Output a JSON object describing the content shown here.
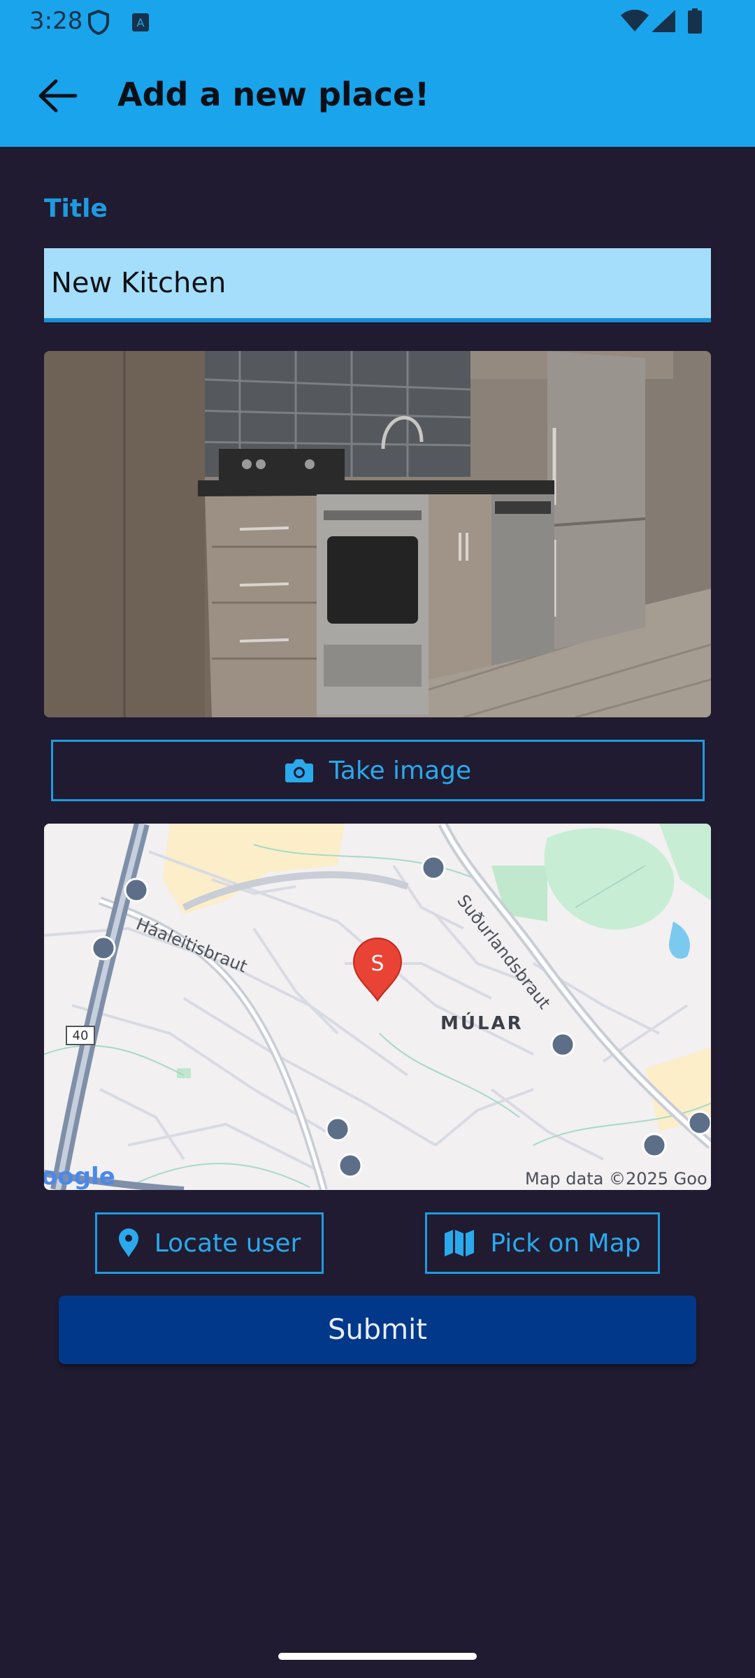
{
  "status_bar": {
    "time": "3:28",
    "icons": [
      "shield-icon",
      "keyboard-a-icon",
      "wifi-icon",
      "signal-icon",
      "battery-icon"
    ]
  },
  "app_bar": {
    "title": "Add a new place!",
    "back_icon": "arrow-left-icon"
  },
  "form": {
    "title_label": "Title",
    "title_value": "New Kitchen",
    "take_image_label": "Take image",
    "locate_user_label": "Locate user",
    "pick_on_map_label": "Pick on Map",
    "submit_label": "Submit"
  },
  "map": {
    "marker_label": "S",
    "street_1": "Háaleitisbraut",
    "street_2": "Suðurlandsbraut",
    "district": "MÚLAR",
    "road_number": "40",
    "logo_text": "oogle",
    "attribution": "Map data ©2025 Goo"
  },
  "colors": {
    "app_bar": "#1aa4ec",
    "background": "#201b31",
    "accent": "#1e9be0",
    "input_fill": "#a5defa",
    "submit": "#02388a"
  }
}
